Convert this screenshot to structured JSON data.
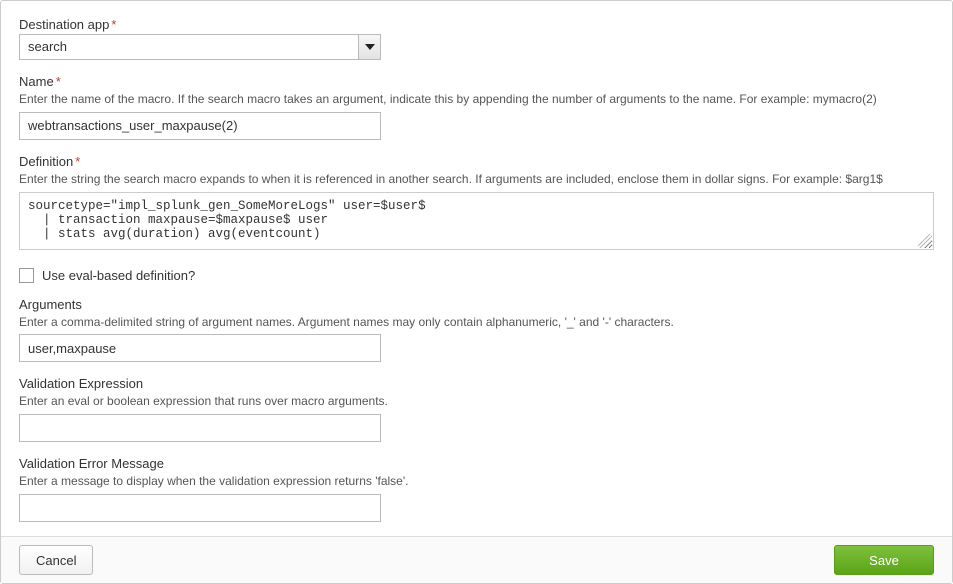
{
  "destinationApp": {
    "label": "Destination app",
    "required": "*",
    "value": "search"
  },
  "name": {
    "label": "Name",
    "required": "*",
    "hint": "Enter the name of the macro. If the search macro takes an argument, indicate this by appending the number of arguments to the name. For example: mymacro(2)",
    "value": "webtransactions_user_maxpause(2)"
  },
  "definition": {
    "label": "Definition",
    "required": "*",
    "hint": "Enter the string the search macro expands to when it is referenced in another search. If arguments are included, enclose them in dollar signs. For example: $arg1$",
    "value": "sourcetype=\"impl_splunk_gen_SomeMoreLogs\" user=$user$\n  | transaction maxpause=$maxpause$ user\n  | stats avg(duration) avg(eventcount)"
  },
  "evalBased": {
    "label": "Use eval-based definition?",
    "checked": false
  },
  "arguments": {
    "label": "Arguments",
    "hint": "Enter a comma-delimited string of argument names. Argument names may only contain alphanumeric, '_' and '-' characters.",
    "value": "user,maxpause"
  },
  "validationExpr": {
    "label": "Validation Expression",
    "hint": "Enter an eval or boolean expression that runs over macro arguments.",
    "value": ""
  },
  "validationErr": {
    "label": "Validation Error Message",
    "hint": "Enter a message to display when the validation expression returns 'false'.",
    "value": ""
  },
  "buttons": {
    "cancel": "Cancel",
    "save": "Save"
  }
}
